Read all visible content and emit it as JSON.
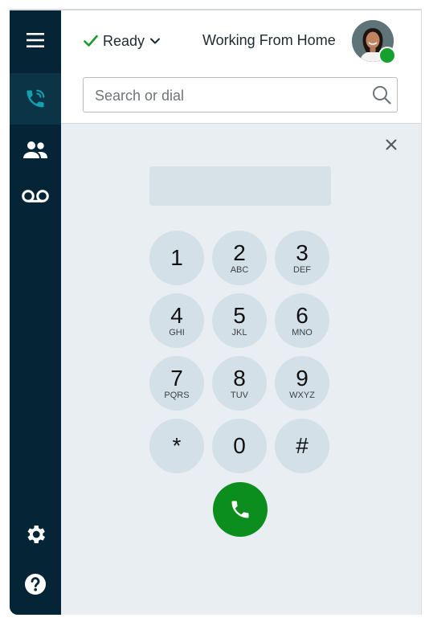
{
  "sidebar": {
    "items": [
      {
        "name": "menu-icon"
      },
      {
        "name": "phone-icon",
        "active": true
      },
      {
        "name": "contacts-icon"
      },
      {
        "name": "voicemail-icon"
      },
      {
        "name": "settings-icon"
      },
      {
        "name": "help-icon"
      }
    ]
  },
  "header": {
    "status": "Ready",
    "location": "Working From Home"
  },
  "search": {
    "placeholder": "Search or dial"
  },
  "keypad": {
    "keys": [
      {
        "digit": "1",
        "letters": ""
      },
      {
        "digit": "2",
        "letters": "ABC"
      },
      {
        "digit": "3",
        "letters": "DEF"
      },
      {
        "digit": "4",
        "letters": "GHI"
      },
      {
        "digit": "5",
        "letters": "JKL"
      },
      {
        "digit": "6",
        "letters": "MNO"
      },
      {
        "digit": "7",
        "letters": "PQRS"
      },
      {
        "digit": "8",
        "letters": "TUV"
      },
      {
        "digit": "9",
        "letters": "WXYZ"
      },
      {
        "digit": "*",
        "letters": ""
      },
      {
        "digit": "0",
        "letters": ""
      },
      {
        "digit": "#",
        "letters": ""
      }
    ]
  },
  "colors": {
    "sidebar": "#052536",
    "accent": "#13a0b0",
    "call": "#0c8e1f",
    "presence": "#16a02e"
  }
}
